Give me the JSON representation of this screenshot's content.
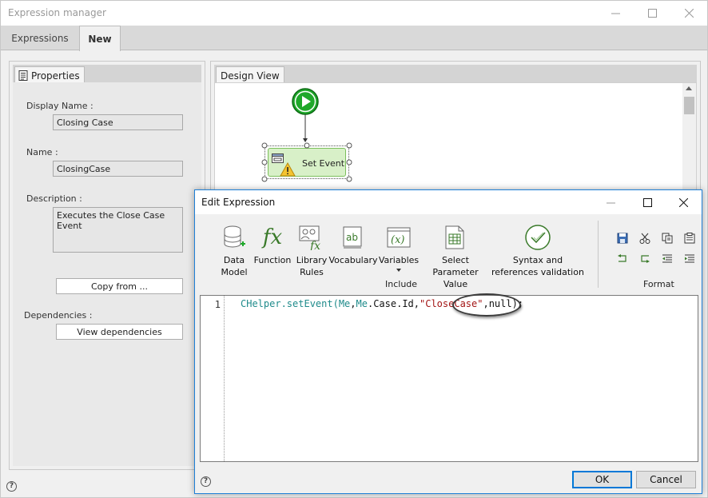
{
  "window": {
    "title": "Expression manager"
  },
  "tabs": [
    {
      "label": "Expressions",
      "active": false
    },
    {
      "label": "New",
      "active": true
    }
  ],
  "properties": {
    "tab_label": "Properties",
    "display_name_label": "Display Name :",
    "display_name_value": "Closing Case",
    "name_label": "Name :",
    "name_value": "ClosingCase",
    "description_label": "Description :",
    "description_value": "Executes the Close Case Event",
    "copy_from_label": "Copy from ...",
    "dependencies_label": "Dependencies :",
    "view_dependencies_label": "View dependencies"
  },
  "design_view": {
    "tab_label": "Design View",
    "node_label": "Set Event"
  },
  "dialog": {
    "title": "Edit Expression",
    "ribbon": {
      "data_model": "Data Model",
      "function": "Function",
      "library_rules": "Library Rules",
      "vocabulary": "Vocabulary",
      "variables": "Variables",
      "select_parameter_value": "Select Parameter Value",
      "syntax_validation": "Syntax and references validation",
      "include_group": "Include",
      "format_group": "Format"
    },
    "editor": {
      "line_number": "1",
      "code_prefix": "CHelper.setEvent(",
      "code_me1": "Me",
      "code_comma1": ",",
      "code_me2": "Me",
      "code_case_id": ".Case.Id,",
      "code_string": "\"CloseCase\"",
      "code_suffix": ",null);"
    },
    "ok_label": "OK",
    "cancel_label": "Cancel",
    "help_label": "?"
  },
  "status": {
    "help_label": "?"
  },
  "colors": {
    "dialog_border": "#1e7fd6",
    "node_fill": "#d8f0c8",
    "start_green": "#1fa82a",
    "code_teal": "#1f8b8b",
    "code_string": "#a31515"
  }
}
